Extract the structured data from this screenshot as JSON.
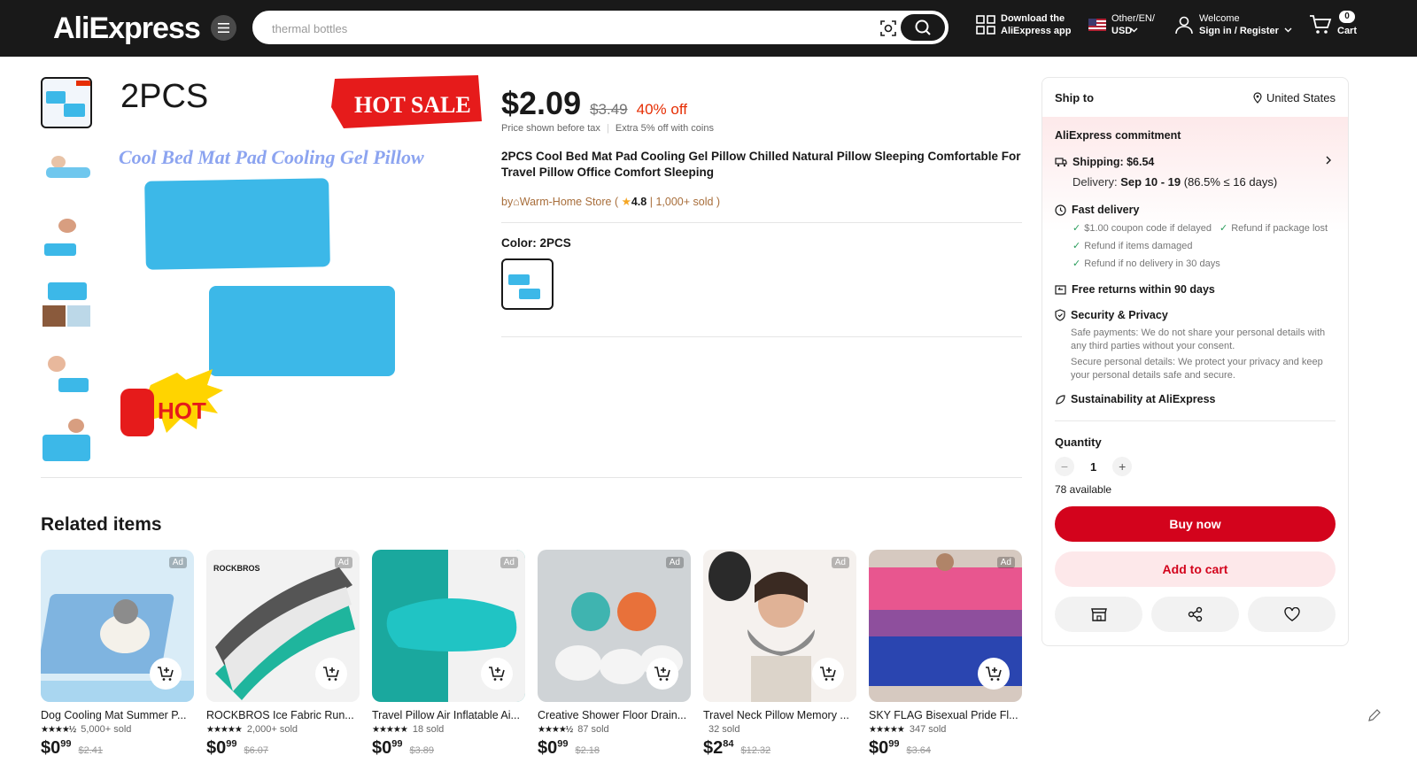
{
  "header": {
    "logo": "AliExpress",
    "search_placeholder": "thermal bottles",
    "download_line1": "Download the",
    "download_line2": "AliExpress app",
    "locale_line1": "Other/EN/",
    "locale_line2": "USD",
    "welcome": "Welcome",
    "sign_in": "Sign in / Register",
    "cart_count": "0",
    "cart_label": "Cart"
  },
  "gallery": {
    "badge_2pcs": "2PCS",
    "badge_hot_sale": "HOT SALE",
    "caption": "Cool Bed Mat Pad Cooling Gel Pillow",
    "badge_hot": "HOT"
  },
  "product": {
    "price": "$2.09",
    "old_price": "$3.49",
    "discount": "40% off",
    "tax_note": "Price shown before tax",
    "coins_note": "Extra 5% off with coins",
    "title": "2PCS Cool Bed Mat Pad Cooling Gel Pillow Chilled Natural Pillow Sleeping Comfortable For Travel Pillow Office Comfort Sleeping",
    "by": "by",
    "store": "Warm-Home Store",
    "rating": "4.8",
    "sold": "1,000+ sold",
    "color_label": "Color: 2PCS"
  },
  "panel": {
    "ship_to": "Ship to",
    "country": "United States",
    "commitment": "AliExpress commitment",
    "shipping": "Shipping: $6.54",
    "delivery_label": "Delivery: ",
    "delivery_dates": "Sep 10 - 19",
    "delivery_rate": " (86.5% ≤ 16 days)",
    "fast_delivery": "Fast delivery",
    "fd_1": "$1.00 coupon code if delayed",
    "fd_2": "Refund if package lost",
    "fd_3": "Refund if items damaged",
    "fd_4": "Refund if no delivery in 30 days",
    "free_returns": "Free returns within 90 days",
    "security": "Security & Privacy",
    "sec_1": "Safe payments: We do not share your personal details with any third parties without your consent.",
    "sec_2": "Secure personal details: We protect your privacy and keep your personal details safe and secure.",
    "sustain": "Sustainability at AliExpress",
    "quantity_label": "Quantity",
    "quantity": "1",
    "available": "78 available",
    "buy_now": "Buy now",
    "add_to_cart": "Add to cart"
  },
  "related": {
    "title": "Related items",
    "ad_label": "Ad",
    "items": [
      {
        "name": "Dog Cooling Mat Summer P...",
        "sold": "5,000+ sold",
        "price_int": "$0",
        "price_dec": "99",
        "old": "$2.41",
        "stars": "★★★★½",
        "bg": "#d9ecf7"
      },
      {
        "name": "ROCKBROS Ice Fabric Run...",
        "sold": "2,000+ sold",
        "price_int": "$0",
        "price_dec": "99",
        "old": "$6.07",
        "stars": "★★★★★",
        "bg": "#f2f2f2",
        "brand": "ROCKBROS"
      },
      {
        "name": "Travel Pillow Air Inflatable Ai...",
        "sold": "18 sold",
        "price_int": "$0",
        "price_dec": "99",
        "old": "$3.89",
        "stars": "★★★★★",
        "bg": "#1aa89e"
      },
      {
        "name": "Creative Shower Floor Drain...",
        "sold": "87 sold",
        "price_int": "$0",
        "price_dec": "99",
        "old": "$2.18",
        "stars": "★★★★½",
        "bg": "#cfd3d6"
      },
      {
        "name": "Travel Neck Pillow Memory ...",
        "sold": "32 sold",
        "price_int": "$2",
        "price_dec": "84",
        "old": "$12.32",
        "stars": "",
        "bg": "#efe9e4"
      },
      {
        "name": "SKY FLAG Bisexual Pride Fl...",
        "sold": "347 sold",
        "price_int": "$0",
        "price_dec": "99",
        "old": "$3.64",
        "stars": "★★★★★",
        "bg": "#d6c9c0"
      }
    ]
  },
  "colors": {
    "header_bg": "#191919",
    "accent_red": "#d3031c",
    "discount_red": "#e62e04",
    "product_blue": "#3cb8e8",
    "store_brown": "#a86e3b"
  }
}
